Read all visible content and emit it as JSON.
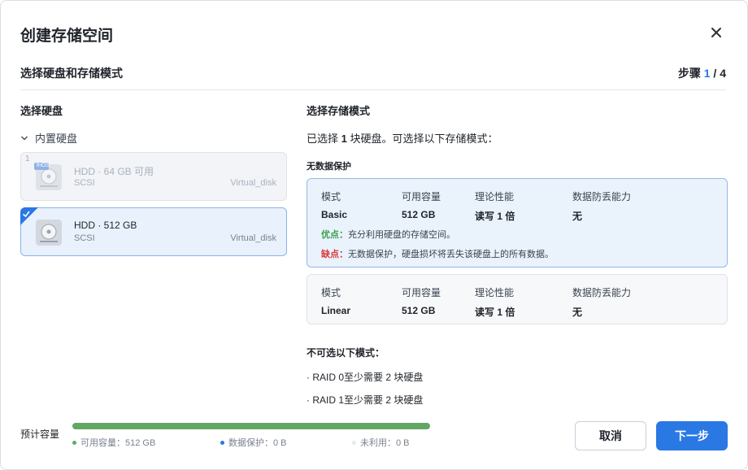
{
  "dialog": {
    "title": "创建存储空间",
    "subtitle": "选择硬盘和存储模式",
    "steps": {
      "prefix": "步骤",
      "current": "1",
      "sep": " / ",
      "total": "4"
    }
  },
  "left": {
    "heading": "选择硬盘",
    "group_label": "内置硬盘",
    "disks": [
      {
        "index": "1",
        "name": "HDD · 64 GB 可用",
        "type": "SCSI",
        "model": "Virtual_disk",
        "badge": "fnOS",
        "selected": false
      },
      {
        "index": "",
        "name": "HDD · 512 GB",
        "type": "SCSI",
        "model": "Virtual_disk",
        "selected": true
      }
    ]
  },
  "right": {
    "heading": "选择存储模式",
    "desc": {
      "pre": "已选择 ",
      "count": "1",
      "post": " 块硬盘。可选择以下存储模式："
    },
    "group_no_protection": "无数据保护",
    "columns": [
      "模式",
      "可用容量",
      "理论性能",
      "数据防丢能力"
    ],
    "modes": [
      {
        "name": "Basic",
        "capacity": "512 GB",
        "performance": "读写 1 倍",
        "protection": "无",
        "pro_label": "优点：",
        "pro_text": "充分利用硬盘的存储空间。",
        "con_label": "缺点：",
        "con_text": "无数据保护，硬盘损坏将丢失该硬盘上的所有数据。"
      },
      {
        "name": "Linear",
        "capacity": "512 GB",
        "performance": "读写 1 倍",
        "protection": "无"
      }
    ],
    "unavailable_heading": "不可选以下模式：",
    "unavailable": [
      {
        "mode": "· RAID 0",
        "reason": "至少需要 2 块硬盘"
      },
      {
        "mode": "· RAID 1",
        "reason": "至少需要 2 块硬盘"
      }
    ]
  },
  "footer": {
    "capacity_label": "预计容量",
    "usage_fraction": 1.0,
    "legend": [
      {
        "text": "可用容量：512 GB",
        "color": "#62a865"
      },
      {
        "text": "数据保护：0 B",
        "color": "#2a78e4"
      },
      {
        "text": "未利用：0 B",
        "color": "#e6e8eb"
      }
    ],
    "cancel_label": "取消",
    "next_label": "下一步"
  },
  "colors": {
    "accent": "#2a78e4",
    "usable": "#62a865",
    "pro": "#3aa04b",
    "con": "#d93a3a"
  }
}
